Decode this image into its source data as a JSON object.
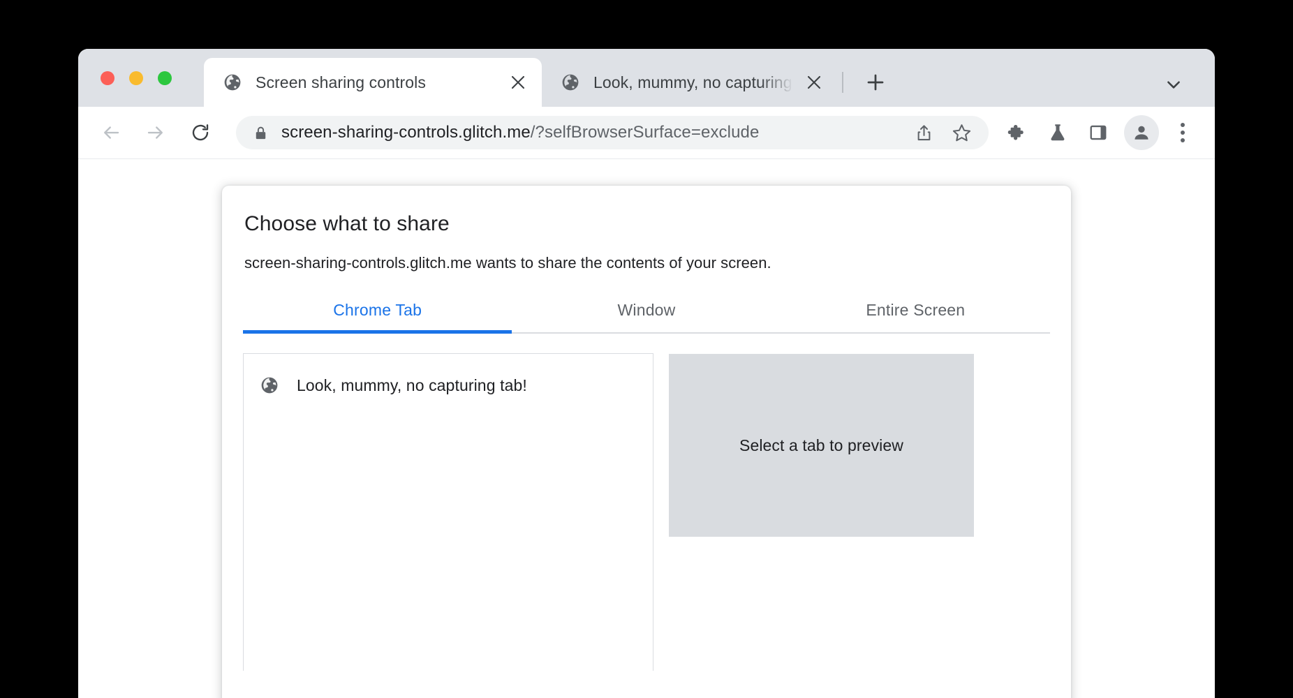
{
  "browser": {
    "window_controls": [
      {
        "name": "close",
        "color": "#fc5f57"
      },
      {
        "name": "minimize",
        "color": "#f9bb2e"
      },
      {
        "name": "maximize",
        "color": "#2dc73f"
      }
    ],
    "tabs": [
      {
        "title": "Screen sharing controls",
        "active": true,
        "favicon": "globe-icon",
        "close_glyph": "✕"
      },
      {
        "title": "Look, mummy, no capturing tab!",
        "active": false,
        "favicon": "globe-icon",
        "close_glyph": "✕"
      }
    ],
    "new_tab_glyph": "+",
    "tab_search_glyph": "⌄",
    "toolbar": {
      "back_glyph": "←",
      "forward_glyph": "→",
      "reload_glyph": "↻",
      "url_domain": "screen-sharing-controls.glitch.me",
      "url_path": "/?selfBrowserSurface=exclude",
      "url_full": "screen-sharing-controls.glitch.me/?selfBrowserSurface=exclude",
      "security_icon": "lock-icon",
      "actions": [
        {
          "name": "share-icon"
        },
        {
          "name": "bookmark-star-icon"
        },
        {
          "name": "extensions-puzzle-icon"
        },
        {
          "name": "experiments-flask-icon"
        },
        {
          "name": "side-panel-icon"
        },
        {
          "name": "profile-avatar-icon"
        },
        {
          "name": "more-menu-icon"
        }
      ]
    }
  },
  "dialog": {
    "title": "Choose what to share",
    "subtitle": "screen-sharing-controls.glitch.me wants to share the contents of your screen.",
    "tabs": [
      {
        "label": "Chrome Tab",
        "active": true
      },
      {
        "label": "Window",
        "active": false
      },
      {
        "label": "Entire Screen",
        "active": false
      }
    ],
    "sources": [
      {
        "label": "Look, mummy, no capturing tab!",
        "favicon": "globe-icon"
      }
    ],
    "preview": {
      "placeholder": "Select a tab to preview",
      "background": "#d9dce0"
    }
  },
  "colors": {
    "accent": "#1a73e8",
    "tabstrip": "#dee1e6",
    "omnibox": "#f1f3f4",
    "text_primary": "#202124",
    "text_secondary": "#5f6368"
  }
}
